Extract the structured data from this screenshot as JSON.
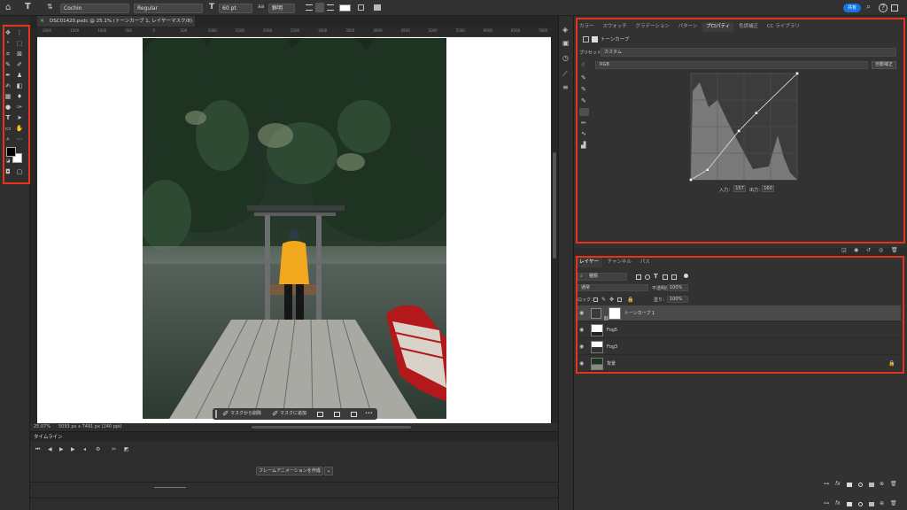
{
  "options_bar": {
    "font_family": "Cochin",
    "font_style": "Regular",
    "font_size": "60 pt",
    "anti_alias": "鮮明",
    "share_button": "共有",
    "type_tool_icon": "T"
  },
  "document": {
    "tab_title": "DSC01420.psdc @ 25.1% (トーンカーブ 1, レイヤーマスク/8) *",
    "zoom": "25.07%",
    "dimensions": "5093 px x 7491 px (240 ppi)",
    "ruler_ticks": [
      "2000",
      "1500",
      "1000",
      "500",
      "0",
      "500",
      "1000",
      "1500",
      "2000",
      "2500",
      "3000",
      "3500",
      "4000",
      "4500",
      "5000",
      "5500",
      "6000",
      "6500",
      "7000"
    ]
  },
  "mask_toolbar": {
    "select_from_mask": "マスクから削除",
    "add_to_mask": "マスクに追加",
    "more": "•••"
  },
  "timeline": {
    "title": "タイムライン",
    "create_frame_animation": "フレームアニメーションを作成"
  },
  "properties_panel": {
    "tabs": [
      "カラー",
      "スウォッチ",
      "グラデーション",
      "パターン",
      "プロパティ",
      "色調補正",
      "CC ライブラリ"
    ],
    "active_tab": "プロパティ",
    "adjustment_name": "トーンカーブ",
    "preset_label": "プリセット：",
    "preset_value": "カスタム",
    "channel_value": "RGB",
    "auto_button": "自動補正",
    "input_label": "入力：",
    "input_value": "157",
    "output_label": "出力：",
    "output_value": "160"
  },
  "curve": {
    "points": [
      [
        0,
        0
      ],
      [
        40,
        24
      ],
      [
        115,
        117
      ],
      [
        157,
        160
      ],
      [
        255,
        255
      ]
    ]
  },
  "layers_panel": {
    "tabs": [
      "レイヤー",
      "チャンネル",
      "パス"
    ],
    "active_tab": "レイヤー",
    "filter_kind": "種類",
    "blend_mode": "通常",
    "opacity_label": "不透明度：",
    "opacity_value": "100%",
    "lock_label": "ロック：",
    "fill_label": "塗り：",
    "fill_value": "100%",
    "layers": [
      {
        "name": "トーンカーブ 1",
        "type": "adjustment",
        "selected": true
      },
      {
        "name": "Fog5",
        "type": "pixel",
        "selected": false
      },
      {
        "name": "Fog3",
        "type": "pixel",
        "selected": false
      },
      {
        "name": "背景",
        "type": "background",
        "selected": false
      }
    ]
  },
  "colors": {
    "highlight_red": "#e8321a",
    "accent_blue": "#1473e6",
    "jacket_yellow": "#f2a81d",
    "boat_red": "#b3181b"
  }
}
